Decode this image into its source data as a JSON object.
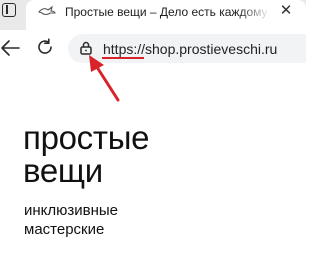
{
  "tab": {
    "title": "Простые вещи – Дело есть каждому",
    "favicon": "bird-logo-icon"
  },
  "address_bar": {
    "url": "https://shop.prostieveschi.ru"
  },
  "colors": {
    "annotation": "#d8232a",
    "text": "#111111",
    "address_bg": "#f1f3f4"
  },
  "page": {
    "brand_title_lines": [
      "простые",
      "вещи"
    ],
    "brand_subtitle_lines": [
      "инклюзивные",
      "мастерские"
    ]
  }
}
